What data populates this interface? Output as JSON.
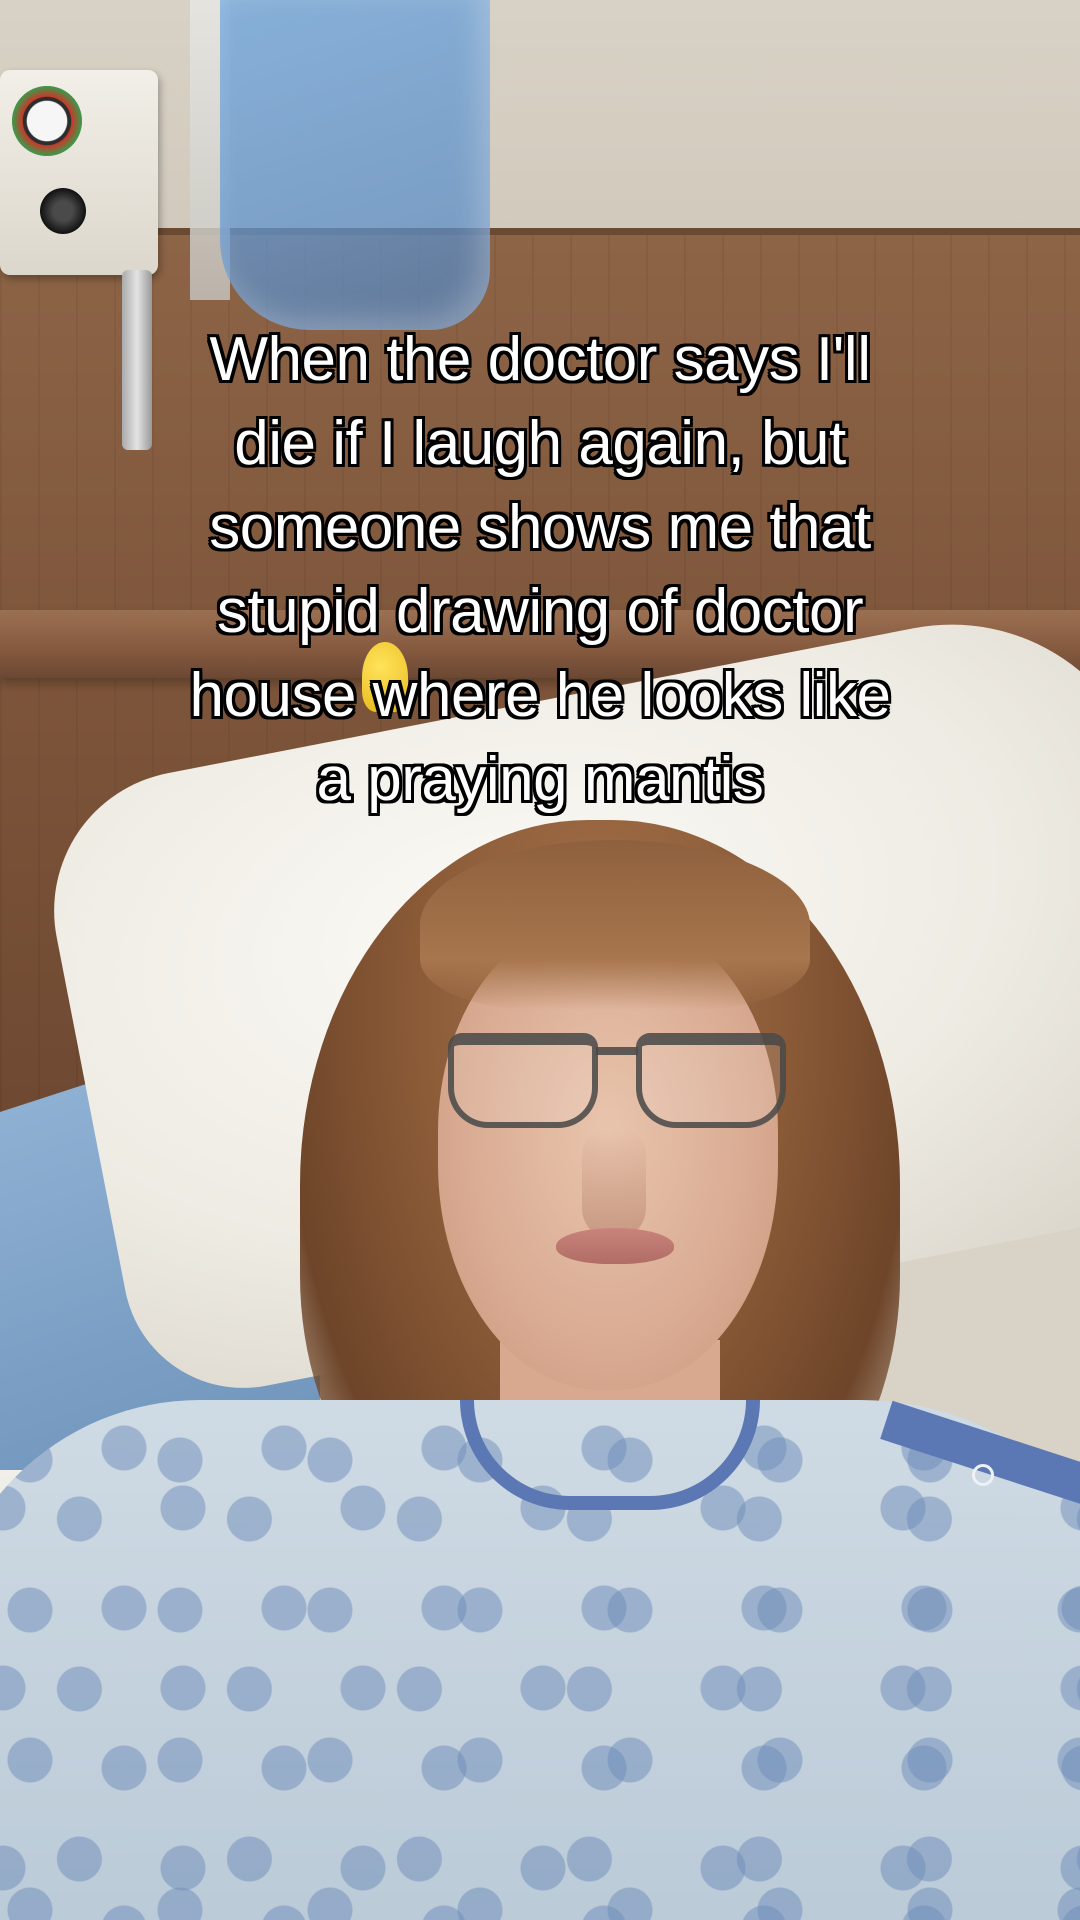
{
  "caption": {
    "lines": [
      "When the doctor says I'll",
      "die if I laugh again, but",
      "someone shows me that",
      "stupid drawing of doctor",
      "house where he looks like",
      "a praying mantis"
    ]
  }
}
